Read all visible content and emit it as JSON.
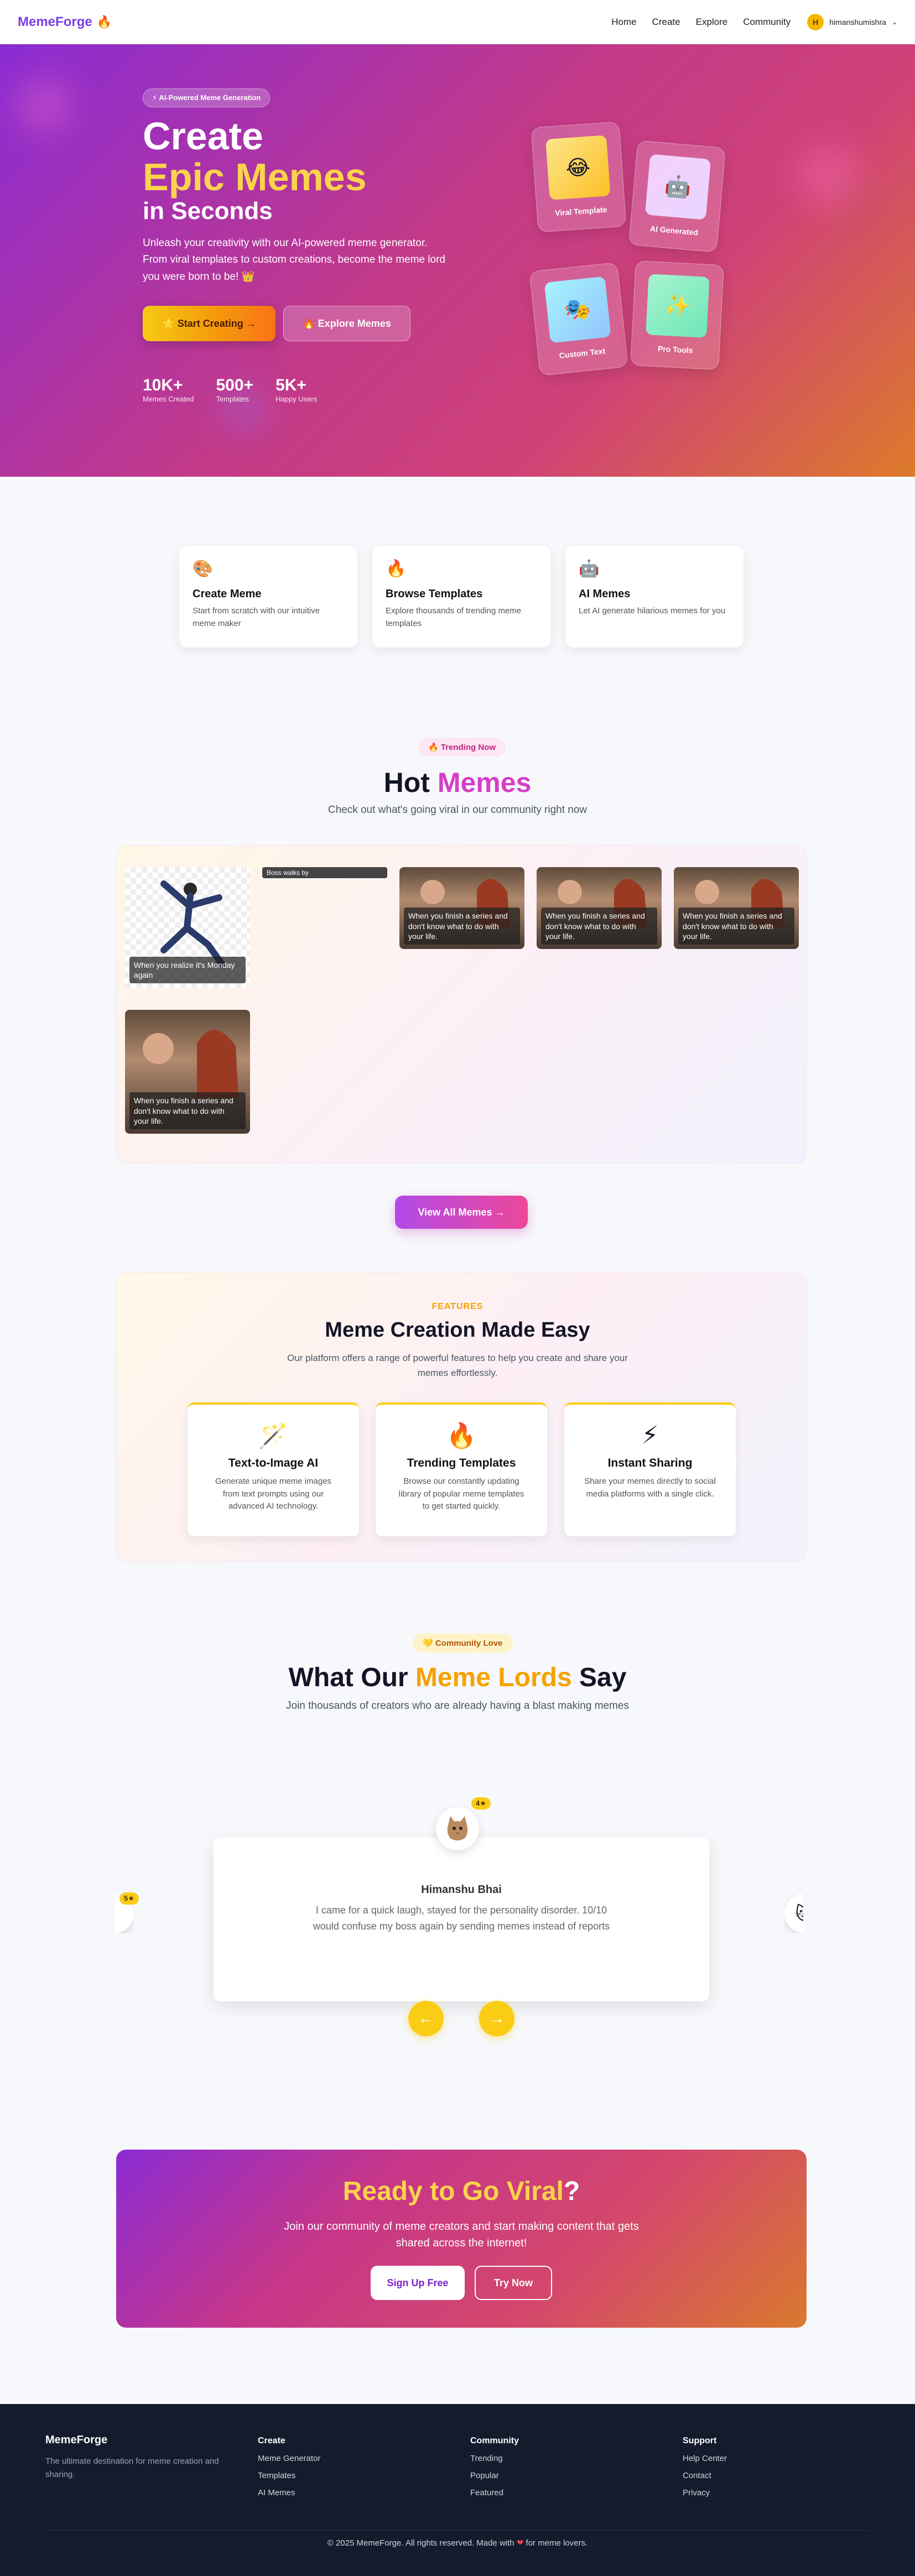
{
  "nav": {
    "brand": "MemeForge",
    "brand_icon": "fire-icon",
    "links": [
      "Home",
      "Create",
      "Explore",
      "Community"
    ],
    "user_initial": "H",
    "user_name": "himanshumishra"
  },
  "hero": {
    "badge": "⚡ AI-Powered Meme Generation",
    "title_line1": "Create",
    "title_line2": "Epic Memes",
    "title_line3": "in Seconds",
    "description": "Unleash your creativity with our AI-powered meme generator. From viral templates to custom creations, become the meme lord you were born to be! 👑",
    "start_button": "⭐ Start Creating →",
    "explore_button": "🔥 Explore Memes",
    "stats": [
      {
        "value": "10K+",
        "label": "Memes Created"
      },
      {
        "value": "500+",
        "label": "Templates"
      },
      {
        "value": "5K+",
        "label": "Happy Users"
      }
    ],
    "feature_cards": [
      {
        "label": "Viral Template",
        "icon": "😂"
      },
      {
        "label": "AI Generated",
        "icon": "🤖"
      },
      {
        "label": "Custom Text",
        "icon": "🎭"
      },
      {
        "label": "Pro Tools",
        "icon": "✨"
      }
    ]
  },
  "quick_cards": [
    {
      "icon": "🎨",
      "title": "Create Meme",
      "desc": "Start from scratch with our intuitive meme maker"
    },
    {
      "icon": "🔥",
      "title": "Browse Templates",
      "desc": "Explore thousands of trending meme templates"
    },
    {
      "icon": "🤖",
      "title": "AI Memes",
      "desc": "Let AI generate hilarious memes for you"
    }
  ],
  "trending": {
    "badge": "🔥 Trending Now",
    "title_a": "Hot",
    "title_b": "Memes",
    "subtitle": "Check out what's going viral in our community right now",
    "memes": [
      {
        "caption": "When you realize it's Monday again"
      },
      {
        "caption": "Boss walks by"
      },
      {
        "caption": "When you finish a series and don't know what to do with your life."
      },
      {
        "caption": "When you finish a series and don't know what to do with your life."
      },
      {
        "caption": "When you finish a series and don't know what to do with your life."
      },
      {
        "caption": "When you finish a series and don't know what to do with your life."
      }
    ],
    "view_all": "View All Memes →"
  },
  "features": {
    "kicker": "FEATURES",
    "title": "Meme Creation Made Easy",
    "subtitle": "Our platform offers a range of powerful features to help you create and share your memes effortlessly.",
    "items": [
      {
        "icon": "🪄",
        "title": "Text-to-Image AI",
        "desc": "Generate unique meme images from text prompts using our advanced AI technology."
      },
      {
        "icon": "🔥",
        "title": "Trending Templates",
        "desc": "Browse our constantly updating library of popular meme templates to get started quickly."
      },
      {
        "icon": "⚡",
        "title": "Instant Sharing",
        "desc": "Share your memes directly to social media platforms with a single click."
      }
    ]
  },
  "testimonials": {
    "badge": "💛 Community Love",
    "title_a": "What Our",
    "title_b": "Meme Lords",
    "title_c": "Say",
    "subtitle": "Join thousands of creators who are already having a blast making memes",
    "name": "Himanshu Bhai",
    "quote": "I came for a quick laugh, stayed for the personality disorder. 10/10 would confuse my boss again by sending memes instead of reports",
    "rating_center": "4★",
    "rating_left": "5★",
    "avatar_icon": "cat-avatar-icon",
    "prev": "←",
    "next": "→"
  },
  "cta": {
    "title_a": "Ready to Go",
    "title_b": "Viral",
    "title_c": "?",
    "desc": "Join our community of meme creators and start making content that gets shared across the internet!",
    "signup": "Sign Up Free",
    "try": "Try Now"
  },
  "footer": {
    "brand": "MemeForge",
    "desc": "The ultimate destination for meme creation and sharing.",
    "columns": [
      {
        "title": "Create",
        "items": [
          "Meme Generator",
          "Templates",
          "AI Memes"
        ]
      },
      {
        "title": "Community",
        "items": [
          "Trending",
          "Popular",
          "Featured"
        ]
      },
      {
        "title": "Support",
        "items": [
          "Help Center",
          "Contact",
          "Privacy"
        ]
      }
    ],
    "copyright_a": "© 2025 MemeForge. All rights reserved. Made with",
    "copyright_heart": "❤",
    "copyright_b": "for meme lovers."
  }
}
